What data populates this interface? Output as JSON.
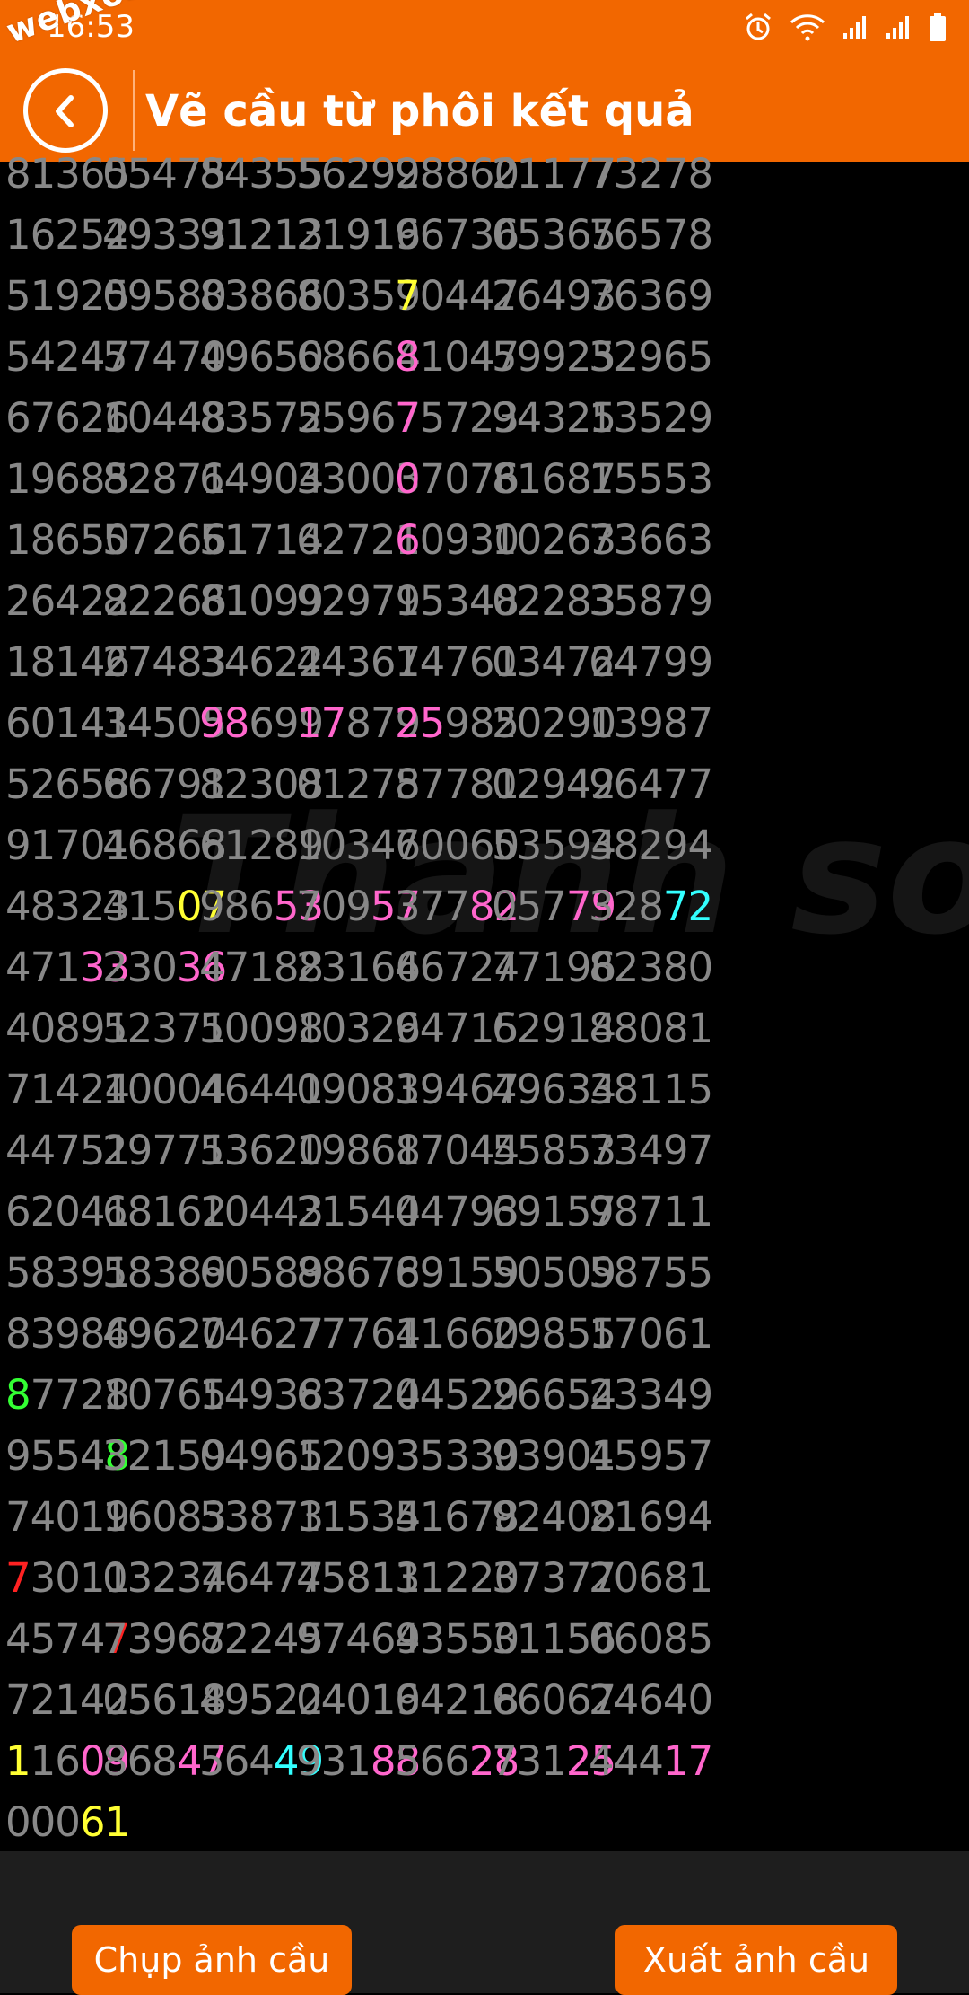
{
  "status": {
    "time": "16:53"
  },
  "watermark_text": "webxoso.net",
  "header": {
    "title": "Vẽ cầu từ phôi kết quả"
  },
  "buttons": {
    "capture": "Chụp ảnh cầu",
    "export": "Xuất ảnh cầu"
  },
  "colors": {
    "accent": "#f26700",
    "digit": "#888888",
    "pink": "#ff66cc",
    "yellow": "#ffff33",
    "cyan": "#33ffff",
    "green": "#33ff33",
    "red": "#ff2222"
  },
  "icons": {
    "back": "chevron-left-icon",
    "alarm": "alarm-icon",
    "wifi": "wifi-icon",
    "signal": "signal-icon",
    "battery": "battery-icon"
  },
  "rows": [
    [
      [
        [
          "81365",
          ""
        ]
      ],
      [
        [
          "05475",
          ""
        ]
      ],
      [
        [
          "84355",
          ""
        ]
      ],
      [
        [
          "56292",
          ""
        ]
      ],
      [
        [
          "98860",
          ""
        ]
      ],
      [
        [
          "21177",
          ""
        ]
      ],
      [
        [
          "73278",
          ""
        ]
      ]
    ],
    [
      [
        [
          "16252",
          ""
        ]
      ],
      [
        [
          "49333",
          ""
        ]
      ],
      [
        [
          "91213",
          ""
        ]
      ],
      [
        [
          "21916",
          ""
        ]
      ],
      [
        [
          "96736",
          ""
        ]
      ],
      [
        [
          "05365",
          ""
        ]
      ],
      [
        [
          "76578",
          ""
        ]
      ]
    ],
    [
      [
        [
          "51925",
          ""
        ]
      ],
      [
        [
          "09580",
          ""
        ]
      ],
      [
        [
          "83866",
          ""
        ]
      ],
      [
        [
          "80359",
          ""
        ]
      ],
      [
        [
          "7",
          "yellow"
        ],
        [
          "0447",
          ""
        ]
      ],
      [
        [
          "26493",
          ""
        ]
      ],
      [
        [
          "76369",
          ""
        ]
      ]
    ],
    [
      [
        [
          "54247",
          ""
        ]
      ],
      [
        [
          "57470",
          ""
        ]
      ],
      [
        [
          "49650",
          ""
        ]
      ],
      [
        [
          "68664",
          ""
        ]
      ],
      [
        [
          "8",
          "pink"
        ],
        [
          "1047",
          ""
        ]
      ],
      [
        [
          "59925",
          ""
        ]
      ],
      [
        [
          "32965",
          ""
        ]
      ]
    ],
    [
      [
        [
          "67626",
          ""
        ]
      ],
      [
        [
          "10448",
          ""
        ]
      ],
      [
        [
          "83572",
          ""
        ]
      ],
      [
        [
          "55967",
          ""
        ]
      ],
      [
        [
          "7",
          "pink"
        ],
        [
          "5723",
          ""
        ]
      ],
      [
        [
          "94325",
          ""
        ]
      ],
      [
        [
          "13529",
          ""
        ]
      ]
    ],
    [
      [
        [
          "19685",
          ""
        ]
      ],
      [
        [
          "82871",
          ""
        ]
      ],
      [
        [
          "64904",
          ""
        ]
      ],
      [
        [
          "33003",
          ""
        ]
      ],
      [
        [
          "0",
          "pink"
        ],
        [
          "7076",
          ""
        ]
      ],
      [
        [
          "81687",
          ""
        ]
      ],
      [
        [
          "15553",
          ""
        ]
      ]
    ],
    [
      [
        [
          "18650",
          ""
        ]
      ],
      [
        [
          "57266",
          ""
        ]
      ],
      [
        [
          "51714",
          ""
        ]
      ],
      [
        [
          "62721",
          ""
        ]
      ],
      [
        [
          "6",
          "pink"
        ],
        [
          "0930",
          ""
        ]
      ],
      [
        [
          "10263",
          ""
        ]
      ],
      [
        [
          "73663",
          ""
        ]
      ]
    ],
    [
      [
        [
          "26422",
          ""
        ]
      ],
      [
        [
          "82266",
          ""
        ]
      ],
      [
        [
          "81099",
          ""
        ]
      ],
      [
        [
          "92979",
          ""
        ]
      ],
      [
        [
          "15348",
          ""
        ]
      ],
      [
        [
          "02283",
          ""
        ]
      ],
      [
        [
          "35879",
          ""
        ]
      ]
    ],
    [
      [
        [
          "18146",
          ""
        ]
      ],
      [
        [
          "27483",
          ""
        ]
      ],
      [
        [
          "34622",
          ""
        ]
      ],
      [
        [
          "44367",
          ""
        ]
      ],
      [
        [
          "14761",
          ""
        ]
      ],
      [
        [
          "03472",
          ""
        ]
      ],
      [
        [
          "64799",
          ""
        ]
      ]
    ],
    [
      [
        [
          "60141",
          ""
        ]
      ],
      [
        [
          "34505",
          ""
        ]
      ],
      [
        [
          "98",
          "pink"
        ],
        [
          "699",
          ""
        ]
      ],
      [
        [
          "17",
          "pink"
        ],
        [
          "879",
          ""
        ]
      ],
      [
        [
          "25",
          "pink"
        ],
        [
          "985",
          ""
        ]
      ],
      [
        [
          "20290",
          ""
        ]
      ],
      [
        [
          "13987",
          ""
        ]
      ]
    ],
    [
      [
        [
          "52658",
          ""
        ]
      ],
      [
        [
          "66791",
          ""
        ]
      ],
      [
        [
          "82308",
          ""
        ]
      ],
      [
        [
          "01275",
          ""
        ]
      ],
      [
        [
          "87781",
          ""
        ]
      ],
      [
        [
          "02942",
          ""
        ]
      ],
      [
        [
          "96477",
          ""
        ]
      ]
    ],
    [
      [
        [
          "91701",
          ""
        ]
      ],
      [
        [
          "46868",
          ""
        ]
      ],
      [
        [
          "61289",
          ""
        ]
      ],
      [
        [
          "10346",
          ""
        ]
      ],
      [
        [
          "70060",
          ""
        ]
      ],
      [
        [
          "53594",
          ""
        ]
      ],
      [
        [
          "38294",
          ""
        ]
      ]
    ],
    [
      [
        [
          "48323",
          ""
        ]
      ],
      [
        [
          "415",
          ""
        ],
        [
          "07",
          "yellow"
        ]
      ],
      [
        [
          "986",
          ""
        ],
        [
          "53",
          "pink"
        ]
      ],
      [
        [
          "709",
          ""
        ],
        [
          "57",
          "pink"
        ]
      ],
      [
        [
          "377",
          ""
        ],
        [
          "82",
          "pink"
        ]
      ],
      [
        [
          "057",
          ""
        ],
        [
          "79",
          "pink"
        ]
      ],
      [
        [
          "328",
          ""
        ],
        [
          "72",
          "cyan"
        ]
      ]
    ],
    [
      [
        [
          "471",
          ""
        ],
        [
          "33",
          "pink"
        ]
      ],
      [
        [
          "230",
          ""
        ],
        [
          "36",
          "pink"
        ]
      ],
      [
        [
          "47188",
          ""
        ]
      ],
      [
        [
          "23166",
          ""
        ]
      ],
      [
        [
          "46724",
          ""
        ]
      ],
      [
        [
          "77196",
          ""
        ]
      ],
      [
        [
          "82380",
          ""
        ]
      ]
    ],
    [
      [
        [
          "40891",
          ""
        ]
      ],
      [
        [
          "52371",
          ""
        ]
      ],
      [
        [
          "50098",
          ""
        ]
      ],
      [
        [
          "10326",
          ""
        ]
      ],
      [
        [
          "94715",
          ""
        ]
      ],
      [
        [
          "62914",
          ""
        ]
      ],
      [
        [
          "88081",
          ""
        ]
      ]
    ],
    [
      [
        [
          "71424",
          ""
        ]
      ],
      [
        [
          "10004",
          ""
        ]
      ],
      [
        [
          "46441",
          ""
        ]
      ],
      [
        [
          "09081",
          ""
        ]
      ],
      [
        [
          "39467",
          ""
        ]
      ],
      [
        [
          "49634",
          ""
        ]
      ],
      [
        [
          "38115",
          ""
        ]
      ]
    ],
    [
      [
        [
          "44751",
          ""
        ]
      ],
      [
        [
          "29771",
          ""
        ]
      ],
      [
        [
          "53620",
          ""
        ]
      ],
      [
        [
          "19868",
          ""
        ]
      ],
      [
        [
          "17044",
          ""
        ]
      ],
      [
        [
          "55853",
          ""
        ]
      ],
      [
        [
          "73497",
          ""
        ]
      ]
    ],
    [
      [
        [
          "62041",
          ""
        ]
      ],
      [
        [
          "68162",
          ""
        ]
      ],
      [
        [
          "10443",
          ""
        ]
      ],
      [
        [
          "21544",
          ""
        ]
      ],
      [
        [
          "04793",
          ""
        ]
      ],
      [
        [
          "69157",
          ""
        ]
      ],
      [
        [
          "98711",
          ""
        ]
      ]
    ],
    [
      [
        [
          "58391",
          ""
        ]
      ],
      [
        [
          "58389",
          ""
        ]
      ],
      [
        [
          "60589",
          ""
        ]
      ],
      [
        [
          "88678",
          ""
        ]
      ],
      [
        [
          "69159",
          ""
        ]
      ],
      [
        [
          "50509",
          ""
        ]
      ],
      [
        [
          "58755",
          ""
        ]
      ]
    ],
    [
      [
        [
          "83986",
          ""
        ]
      ],
      [
        [
          "49620",
          ""
        ]
      ],
      [
        [
          "74627",
          ""
        ]
      ],
      [
        [
          "77764",
          ""
        ]
      ],
      [
        [
          "11660",
          ""
        ]
      ],
      [
        [
          "29855",
          ""
        ]
      ],
      [
        [
          "17061",
          ""
        ]
      ]
    ],
    [
      [
        [
          "8",
          "green"
        ],
        [
          "7728",
          ""
        ]
      ],
      [
        [
          "10765",
          ""
        ]
      ],
      [
        [
          "14938",
          ""
        ]
      ],
      [
        [
          "63724",
          ""
        ]
      ],
      [
        [
          "04529",
          ""
        ]
      ],
      [
        [
          "26654",
          ""
        ]
      ],
      [
        [
          "23349",
          ""
        ]
      ]
    ],
    [
      [
        [
          "9554",
          ""
        ],
        [
          "8",
          "green"
        ]
      ],
      [
        [
          "32159",
          ""
        ]
      ],
      [
        [
          "04965",
          ""
        ]
      ],
      [
        [
          "12093",
          ""
        ]
      ],
      [
        [
          "35330",
          ""
        ]
      ],
      [
        [
          "93901",
          ""
        ]
      ],
      [
        [
          "45957",
          ""
        ]
      ]
    ],
    [
      [
        [
          "74019",
          ""
        ]
      ],
      [
        [
          "16083",
          ""
        ]
      ],
      [
        [
          "53873",
          ""
        ]
      ],
      [
        [
          "11534",
          ""
        ]
      ],
      [
        [
          "51678",
          ""
        ]
      ],
      [
        [
          "92408",
          ""
        ]
      ],
      [
        [
          "21694",
          ""
        ]
      ]
    ],
    [
      [
        [
          "7",
          "red"
        ],
        [
          "3011",
          ""
        ]
      ],
      [
        [
          "03234",
          ""
        ]
      ],
      [
        [
          "76477",
          ""
        ]
      ],
      [
        [
          "45811",
          ""
        ]
      ],
      [
        [
          "31220",
          ""
        ]
      ],
      [
        [
          "37377",
          ""
        ]
      ],
      [
        [
          "20681",
          ""
        ]
      ]
    ],
    [
      [
        [
          "4574",
          ""
        ],
        [
          "7",
          "red"
        ]
      ],
      [
        [
          "73967",
          ""
        ]
      ],
      [
        [
          "82245",
          ""
        ]
      ],
      [
        [
          "97469",
          ""
        ]
      ],
      [
        [
          "43550",
          ""
        ]
      ],
      [
        [
          "31156",
          ""
        ]
      ],
      [
        [
          "06085",
          ""
        ]
      ]
    ],
    [
      [
        [
          "72142",
          ""
        ]
      ],
      [
        [
          "05618",
          ""
        ]
      ],
      [
        [
          "49522",
          ""
        ]
      ],
      [
        [
          "04019",
          ""
        ]
      ],
      [
        [
          "64218",
          ""
        ]
      ],
      [
        [
          "66067",
          ""
        ]
      ],
      [
        [
          "24640",
          ""
        ]
      ]
    ],
    [
      [
        [
          "1",
          "yellow"
        ],
        [
          "16",
          ""
        ],
        [
          "09",
          "pink"
        ]
      ],
      [
        [
          "868",
          ""
        ],
        [
          "47",
          "pink"
        ]
      ],
      [
        [
          "564",
          ""
        ],
        [
          "49",
          "cyan"
        ]
      ],
      [
        [
          "931",
          ""
        ],
        [
          "88",
          "pink"
        ]
      ],
      [
        [
          "566",
          ""
        ],
        [
          "28",
          "pink"
        ]
      ],
      [
        [
          "731",
          ""
        ],
        [
          "25",
          "pink"
        ]
      ],
      [
        [
          "444",
          ""
        ],
        [
          "17",
          "pink"
        ]
      ]
    ],
    [
      [
        [
          "000",
          ""
        ],
        [
          "61",
          "yellow"
        ]
      ]
    ]
  ]
}
